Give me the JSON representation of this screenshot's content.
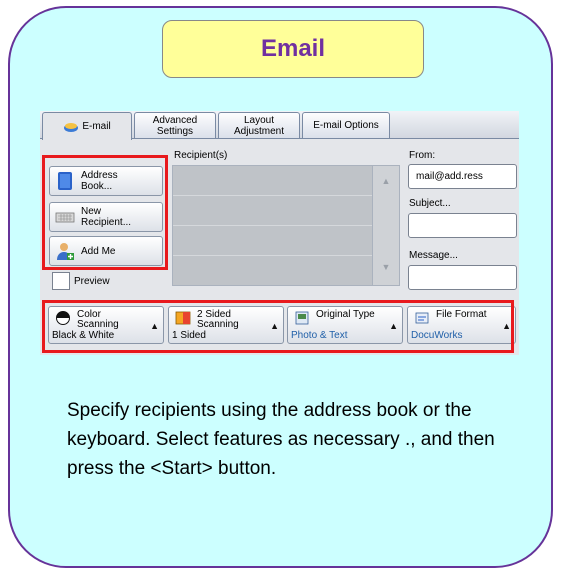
{
  "title": "Email",
  "tabs": [
    {
      "label": "E-mail"
    },
    {
      "label": "Advanced Settings"
    },
    {
      "label": "Layout Adjustment"
    },
    {
      "label": "E-mail Options"
    }
  ],
  "tabs_multiline": {
    "advanced": [
      "Advanced",
      "Settings"
    ],
    "layout": [
      "Layout",
      "Adjustment"
    ]
  },
  "recipients_label": "Recipient(s)",
  "side_buttons": {
    "address_book": [
      "Address",
      "Book..."
    ],
    "new_recipient": [
      "New",
      "Recipient..."
    ],
    "add_me": "Add Me"
  },
  "preview_label": "Preview",
  "from": {
    "label": "From:",
    "value": "mail@add.ress"
  },
  "subject": {
    "label": "Subject...",
    "value": ""
  },
  "message": {
    "label": "Message...",
    "value": ""
  },
  "features": {
    "color": {
      "name": [
        "Color",
        "Scanning"
      ],
      "value": "Black & White"
    },
    "sided": {
      "name": [
        "2 Sided",
        "Scanning"
      ],
      "value": "1 Sided"
    },
    "original": {
      "name": "Original Type",
      "value": "Photo & Text"
    },
    "format": {
      "name": "File Format",
      "value": "DocuWorks"
    }
  },
  "description": "Specify recipients using the address book or the keyboard. Select features as necessary ., and then press the <Start> button.",
  "colors": {
    "card_bg": "#ccffff",
    "card_border": "#663399",
    "title_bg": "#ffff99",
    "title_text": "#7030a0",
    "highlight": "#e8191d"
  },
  "icons": [
    "address-book-icon",
    "keypad-icon",
    "add-me-icon",
    "email-tab-icon",
    "color-scanning-icon",
    "two-sided-icon",
    "original-type-icon",
    "file-format-icon"
  ]
}
